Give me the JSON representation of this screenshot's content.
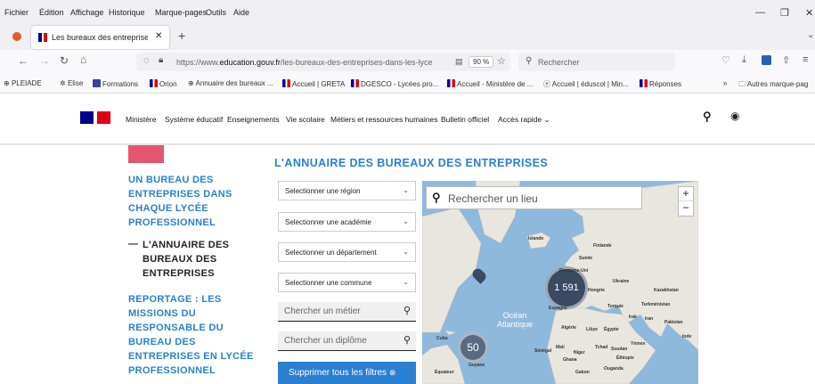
{
  "menubar": {
    "items": [
      "Fichier",
      "Édition",
      "Affichage",
      "Historique",
      "Marque-pages",
      "Outils",
      "Aide"
    ]
  },
  "tab": {
    "title": "Les bureaux des entreprises dar"
  },
  "navbar": {
    "url_prefix": "https://www.",
    "url_domain": "education.gouv.fr",
    "url_path": "/les-bureaux-des-entreprises-dans-les-lyce",
    "zoom": "90 %",
    "search_placeholder": "Rechercher"
  },
  "bookmarks": {
    "items": [
      "PLEIADE",
      "Elise",
      "Formations",
      "Orion",
      "Annuaire des bureaux ...",
      "Accueil | GRETA",
      "DGESCO - Lycées pro...",
      "Accueil - Ministère de ...",
      "Accueil | éduscol | Min...",
      "Réponses"
    ],
    "other": "Autres marque-pag"
  },
  "site_nav": {
    "items": [
      "Ministère",
      "Système éducatif",
      "Enseignements",
      "Vie scolaire",
      "Métiers et ressources humaines",
      "Bulletin officiel",
      "Accès rapide"
    ]
  },
  "sidebar": {
    "link1": [
      "UN BUREAU DES",
      "ENTREPRISES DANS",
      "CHAQUE LYCÉE",
      "PROFESSIONNEL"
    ],
    "current": [
      "L'ANNUAIRE DES",
      "BUREAUX DES",
      "ENTREPRISES"
    ],
    "link2": [
      "REPORTAGE : LES",
      "MISSIONS DU",
      "RESPONSABLE DU",
      "BUREAU DES",
      "ENTREPRISES EN LYCÉE",
      "PROFESSIONNEL"
    ]
  },
  "page": {
    "title": "L'ANNUAIRE DES BUREAUX DES ENTREPRISES"
  },
  "filters": {
    "region": "Selectionner une région",
    "academie": "Selectionner une académie",
    "departement": "Selectionner un département",
    "commune": "Selectionner une commune",
    "metier_placeholder": "Chercher un métier",
    "diplome_placeholder": "Chercher un diplôme",
    "clear_button": "Supprimer tous les filtres"
  },
  "map": {
    "search_placeholder": "Rechercher un lieu",
    "zoom_in": "+",
    "zoom_out": "−",
    "cluster_europe": "1 591",
    "cluster_caribbean": "50",
    "ocean_label_1": "Océan",
    "ocean_label_2": "Atlantique",
    "place_labels": [
      "Islande",
      "Finlande",
      "Suède",
      "Royaume-Uni",
      "Ukraine",
      "Hongrie",
      "Kazakhstan",
      "Espagne",
      "Turquie",
      "Turkménistan",
      "Irak",
      "Iran",
      "Pakistan",
      "Inde",
      "Algérie",
      "Libye",
      "Égypte",
      "Mali",
      "Tchad",
      "Niger",
      "Sénégal",
      "Ghana",
      "Soudan",
      "Yémen",
      "Éthiopie",
      "Ouganda",
      "Gabon",
      "Cuba",
      "Guyane",
      "Équateur"
    ]
  },
  "colors": {
    "accent_blue": "#2a7fd0",
    "brand_red": "#e1000f",
    "brand_navy": "#000091",
    "pink": "#e4566f",
    "cluster": "#3a4a63"
  }
}
